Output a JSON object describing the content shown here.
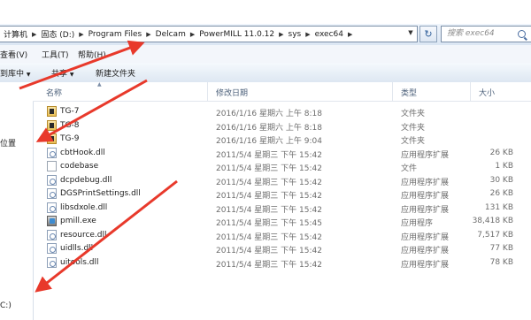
{
  "address": {
    "crumbs": [
      "计算机",
      "固态 (D:)",
      "Program Files",
      "Delcam",
      "PowerMILL 11.0.12",
      "sys",
      "exec64"
    ],
    "search_placeholder": "搜索 exec64"
  },
  "menu": {
    "view": "查看(V)",
    "tools": "工具(T)",
    "help": "帮助(H)"
  },
  "toolbar": {
    "include_in_library": "到库中",
    "share": "共享",
    "new_folder": "新建文件夹"
  },
  "nav": {
    "item_location": "位置",
    "item_drive": "C:)"
  },
  "columns": {
    "name": "名称",
    "modified": "修改日期",
    "type": "类型",
    "size": "大小"
  },
  "files": [
    {
      "name": "TG-7",
      "date": "2016/1/16 星期六 上午 8:18",
      "type": "文件夹",
      "size": "",
      "icon": "folder-icon"
    },
    {
      "name": "TG-8",
      "date": "2016/1/16 星期六 上午 8:18",
      "type": "文件夹",
      "size": "",
      "icon": "folder-icon"
    },
    {
      "name": "TG-9",
      "date": "2016/1/16 星期六 上午 9:04",
      "type": "文件夹",
      "size": "",
      "icon": "folder-icon"
    },
    {
      "name": "cbtHook.dll",
      "date": "2011/5/4 星期三 下午 15:42",
      "type": "应用程序扩展",
      "size": "26 KB",
      "icon": "dll-icon"
    },
    {
      "name": "codebase",
      "date": "2011/5/4 星期三 下午 15:42",
      "type": "文件",
      "size": "1 KB",
      "icon": "file-icon"
    },
    {
      "name": "dcpdebug.dll",
      "date": "2011/5/4 星期三 下午 15:42",
      "type": "应用程序扩展",
      "size": "30 KB",
      "icon": "dll-icon"
    },
    {
      "name": "DGSPrintSettings.dll",
      "date": "2011/5/4 星期三 下午 15:42",
      "type": "应用程序扩展",
      "size": "26 KB",
      "icon": "dll-icon"
    },
    {
      "name": "libsdxole.dll",
      "date": "2011/5/4 星期三 下午 15:42",
      "type": "应用程序扩展",
      "size": "131 KB",
      "icon": "dll-icon"
    },
    {
      "name": "pmill.exe",
      "date": "2011/5/4 星期三 下午 15:45",
      "type": "应用程序",
      "size": "38,418 KB",
      "icon": "exe-icon"
    },
    {
      "name": "resource.dll",
      "date": "2011/5/4 星期三 下午 15:42",
      "type": "应用程序扩展",
      "size": "7,517 KB",
      "icon": "dll-icon"
    },
    {
      "name": "uidlls.dll",
      "date": "2011/5/4 星期三 下午 15:42",
      "type": "应用程序扩展",
      "size": "77 KB",
      "icon": "dll-icon"
    },
    {
      "name": "uitools.dll",
      "date": "2011/5/4 星期三 下午 15:42",
      "type": "应用程序扩展",
      "size": "78 KB",
      "icon": "dll-icon"
    }
  ],
  "colors": {
    "arrow": "#e8392b"
  }
}
